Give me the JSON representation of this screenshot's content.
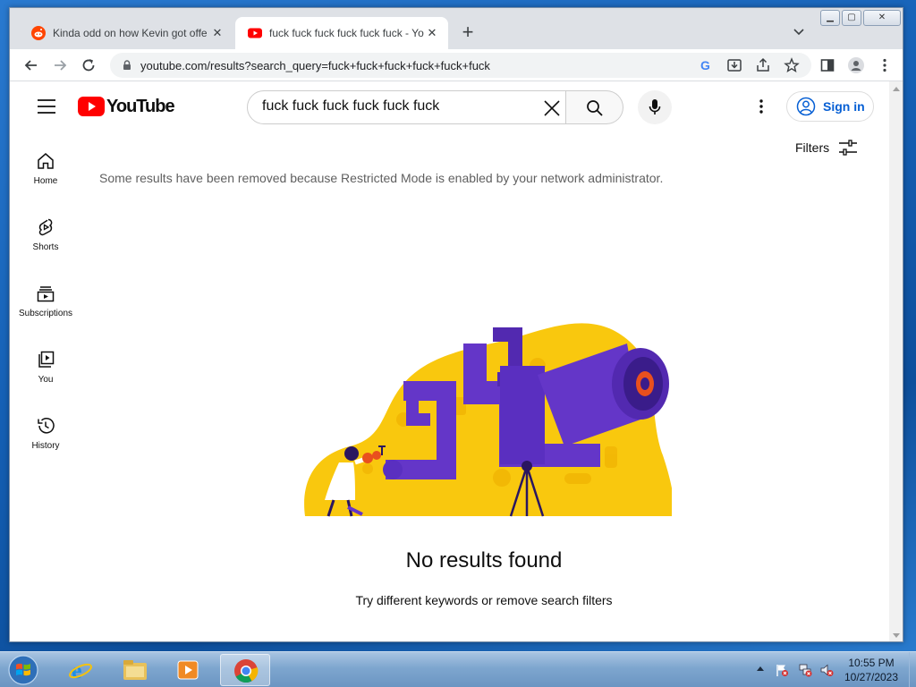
{
  "browser": {
    "tabs": [
      {
        "title": "Kinda odd on how Kevin got offe",
        "favicon": "reddit-icon"
      },
      {
        "title": "fuck fuck fuck fuck fuck fuck - Yo",
        "favicon": "youtube-icon",
        "active": true
      }
    ],
    "new_tab_label": "+",
    "url": "youtube.com/results?search_query=fuck+fuck+fuck+fuck+fuck+fuck"
  },
  "youtube": {
    "logo_text": "YouTube",
    "search_value": "fuck fuck fuck fuck fuck fuck",
    "sign_in_label": "Sign in",
    "filters_label": "Filters",
    "guide": [
      {
        "label": "Home",
        "icon": "home-icon"
      },
      {
        "label": "Shorts",
        "icon": "shorts-icon"
      },
      {
        "label": "Subscriptions",
        "icon": "subscriptions-icon"
      },
      {
        "label": "You",
        "icon": "you-icon"
      },
      {
        "label": "History",
        "icon": "history-icon"
      }
    ],
    "restricted_message": "Some results have been removed because Restricted Mode is enabled by your network administrator.",
    "no_results_title": "No results found",
    "no_results_hint": "Try different keywords or remove search filters"
  },
  "colors": {
    "youtube_red": "#ff0000",
    "link_blue": "#065fd4",
    "illustration_yellow": "#f9c80e",
    "illustration_purple": "#6436c8"
  },
  "taskbar": {
    "time": "10:55 PM",
    "date": "10/27/2023"
  }
}
